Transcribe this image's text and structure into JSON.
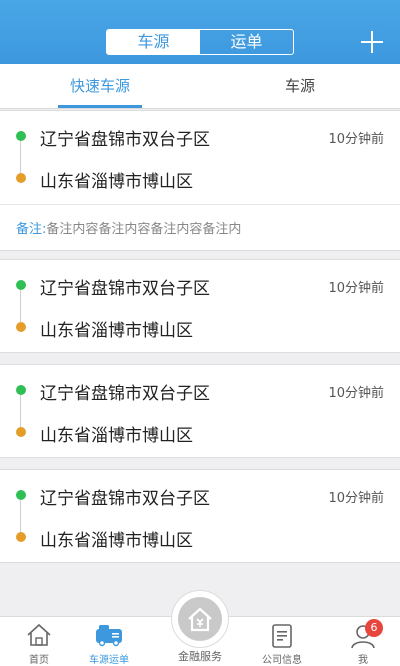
{
  "header": {
    "tabs": [
      {
        "label": "车源",
        "active": true
      },
      {
        "label": "运单",
        "active": false
      }
    ],
    "add_icon": "plus-icon",
    "accent": "#3d98de"
  },
  "subtabs": [
    {
      "label": "快速车源",
      "active": true
    },
    {
      "label": "车源",
      "active": false
    }
  ],
  "listings": [
    {
      "origin": "辽宁省盘锦市双台子区",
      "destination": "山东省淄博市博山区",
      "time": "10分钟前",
      "note_label": "备注:",
      "note": "备注内容备注内容备注内容备注内"
    },
    {
      "origin": "辽宁省盘锦市双台子区",
      "destination": "山东省淄博市博山区",
      "time": "10分钟前"
    },
    {
      "origin": "辽宁省盘锦市双台子区",
      "destination": "山东省淄博市博山区",
      "time": "10分钟前"
    },
    {
      "origin": "辽宁省盘锦市双台子区",
      "destination": "山东省淄博市博山区",
      "time": "10分钟前"
    }
  ],
  "bottom_nav": {
    "items": [
      {
        "label": "首页",
        "icon": "home-icon",
        "active": false
      },
      {
        "label": "车源运单",
        "icon": "truck-icon",
        "active": true
      },
      {
        "label": "金融服务",
        "icon": "finance-icon",
        "active": false
      },
      {
        "label": "公司信息",
        "icon": "document-icon",
        "active": false
      },
      {
        "label": "我",
        "icon": "profile-icon",
        "active": false
      }
    ],
    "badge_count": "6"
  }
}
